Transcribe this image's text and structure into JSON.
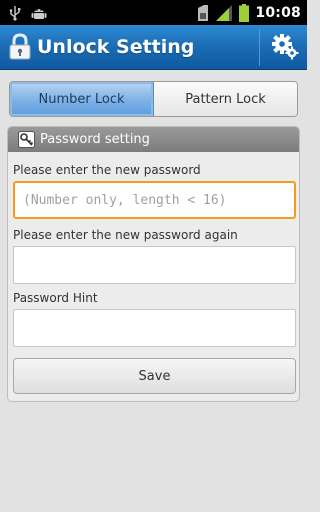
{
  "status_bar": {
    "time": "10:08",
    "icons": [
      "usb-icon",
      "android-debug-icon",
      "sim-icon",
      "signal-icon",
      "battery-icon"
    ]
  },
  "title_bar": {
    "title": "Unlock Setting",
    "icon": "lock-icon",
    "action_icon": "settings-gear-icon"
  },
  "tabs": [
    {
      "label": "Number Lock",
      "active": true
    },
    {
      "label": "Pattern Lock",
      "active": false
    }
  ],
  "panel": {
    "header": "Password setting",
    "fields": [
      {
        "label": "Please enter the new password",
        "value": "",
        "placeholder": "(Number only, length < 16)"
      },
      {
        "label": "Please enter the new password again",
        "value": "",
        "placeholder": ""
      },
      {
        "label": "Password Hint",
        "value": "",
        "placeholder": ""
      }
    ],
    "save_label": "Save"
  },
  "colors": {
    "title_bar": "#1b6cb4",
    "tab_active": "#7db1e6",
    "focus_border": "#f29d1a",
    "panel_header": "#8a8a8a"
  }
}
